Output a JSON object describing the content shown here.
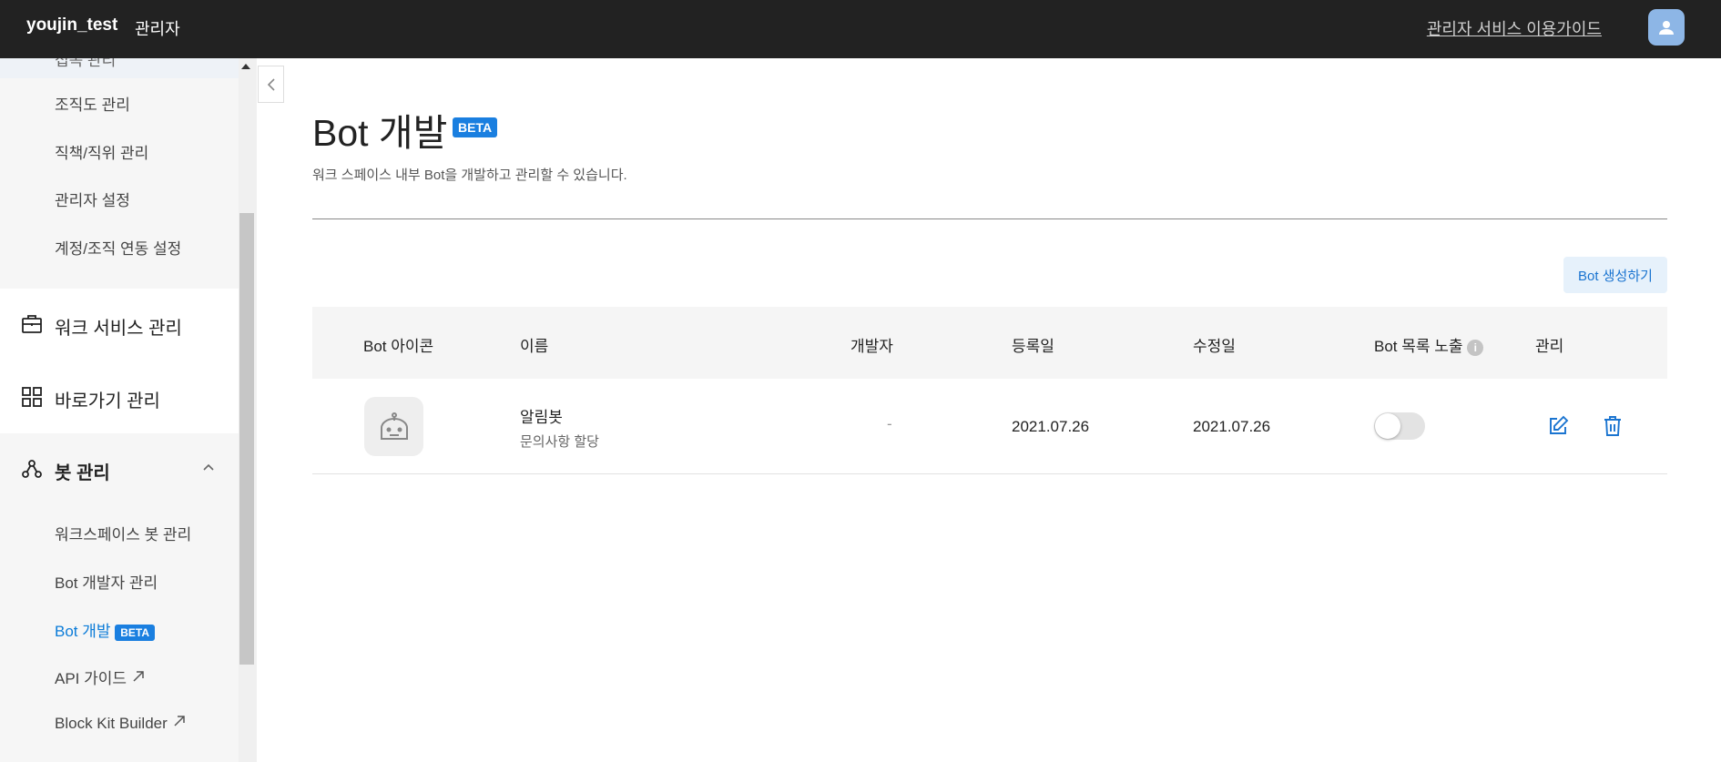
{
  "topbar": {
    "brand": "youjin_test",
    "section": "관리자",
    "guide_link": "관리자 서비스 이용가이드"
  },
  "sidebar": {
    "partial_top_item": "접속 관리",
    "sub_items_1": [
      "조직도 관리",
      "직책/직위 관리",
      "관리자 설정",
      "계정/조직 연동 설정"
    ],
    "main_items": [
      "워크 서비스 관리",
      "바로가기 관리",
      "봇 관리"
    ],
    "bot_sub_items": [
      "워크스페이스 봇 관리",
      "Bot 개발자 관리",
      "Bot 개발",
      "API 가이드",
      "Block Kit Builder"
    ],
    "beta_label": "BETA"
  },
  "page": {
    "title": "Bot 개발",
    "beta": "BETA",
    "description": "워크 스페이스 내부 Bot을 개발하고 관리할 수 있습니다.",
    "create_button": "Bot 생성하기"
  },
  "table": {
    "headers": [
      "Bot 아이콘",
      "이름",
      "개발자",
      "등록일",
      "수정일",
      "Bot 목록 노출",
      "관리"
    ],
    "rows": [
      {
        "name": "알림봇",
        "description": "문의사항 할당",
        "developer": "-",
        "registered": "2021.07.26",
        "modified": "2021.07.26",
        "listed": false
      }
    ]
  },
  "colors": {
    "topbar": "#222222",
    "accent": "#1a7fe0",
    "active_link": "#0a7bd8"
  }
}
